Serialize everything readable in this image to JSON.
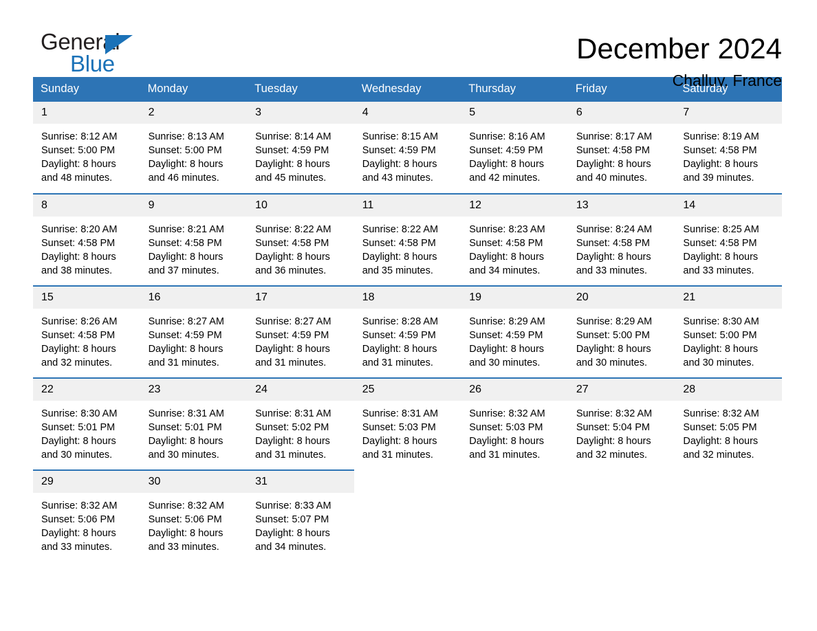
{
  "brand": {
    "name_top": "General",
    "name_bottom": "Blue",
    "triangle_color": "#1b72b8",
    "top_color": "#231f20"
  },
  "header": {
    "title": "December 2024",
    "subtitle": "Challuy, France"
  },
  "theme": {
    "header_blue": "#2d74b5",
    "row_separator": "#2d74b5",
    "daynum_band": "#f0f0f0",
    "page_background": "#ffffff",
    "text": "#000000"
  },
  "calendar": {
    "weekday_headers": [
      "Sunday",
      "Monday",
      "Tuesday",
      "Wednesday",
      "Thursday",
      "Friday",
      "Saturday"
    ],
    "labels": {
      "sunrise": "Sunrise:",
      "sunset": "Sunset:",
      "daylight": "Daylight:"
    },
    "weeks": [
      [
        {
          "day": "1",
          "sunrise": "Sunrise: 8:12 AM",
          "sunset": "Sunset: 5:00 PM",
          "daylight_1": "Daylight: 8 hours",
          "daylight_2": "and 48 minutes."
        },
        {
          "day": "2",
          "sunrise": "Sunrise: 8:13 AM",
          "sunset": "Sunset: 5:00 PM",
          "daylight_1": "Daylight: 8 hours",
          "daylight_2": "and 46 minutes."
        },
        {
          "day": "3",
          "sunrise": "Sunrise: 8:14 AM",
          "sunset": "Sunset: 4:59 PM",
          "daylight_1": "Daylight: 8 hours",
          "daylight_2": "and 45 minutes."
        },
        {
          "day": "4",
          "sunrise": "Sunrise: 8:15 AM",
          "sunset": "Sunset: 4:59 PM",
          "daylight_1": "Daylight: 8 hours",
          "daylight_2": "and 43 minutes."
        },
        {
          "day": "5",
          "sunrise": "Sunrise: 8:16 AM",
          "sunset": "Sunset: 4:59 PM",
          "daylight_1": "Daylight: 8 hours",
          "daylight_2": "and 42 minutes."
        },
        {
          "day": "6",
          "sunrise": "Sunrise: 8:17 AM",
          "sunset": "Sunset: 4:58 PM",
          "daylight_1": "Daylight: 8 hours",
          "daylight_2": "and 40 minutes."
        },
        {
          "day": "7",
          "sunrise": "Sunrise: 8:19 AM",
          "sunset": "Sunset: 4:58 PM",
          "daylight_1": "Daylight: 8 hours",
          "daylight_2": "and 39 minutes."
        }
      ],
      [
        {
          "day": "8",
          "sunrise": "Sunrise: 8:20 AM",
          "sunset": "Sunset: 4:58 PM",
          "daylight_1": "Daylight: 8 hours",
          "daylight_2": "and 38 minutes."
        },
        {
          "day": "9",
          "sunrise": "Sunrise: 8:21 AM",
          "sunset": "Sunset: 4:58 PM",
          "daylight_1": "Daylight: 8 hours",
          "daylight_2": "and 37 minutes."
        },
        {
          "day": "10",
          "sunrise": "Sunrise: 8:22 AM",
          "sunset": "Sunset: 4:58 PM",
          "daylight_1": "Daylight: 8 hours",
          "daylight_2": "and 36 minutes."
        },
        {
          "day": "11",
          "sunrise": "Sunrise: 8:22 AM",
          "sunset": "Sunset: 4:58 PM",
          "daylight_1": "Daylight: 8 hours",
          "daylight_2": "and 35 minutes."
        },
        {
          "day": "12",
          "sunrise": "Sunrise: 8:23 AM",
          "sunset": "Sunset: 4:58 PM",
          "daylight_1": "Daylight: 8 hours",
          "daylight_2": "and 34 minutes."
        },
        {
          "day": "13",
          "sunrise": "Sunrise: 8:24 AM",
          "sunset": "Sunset: 4:58 PM",
          "daylight_1": "Daylight: 8 hours",
          "daylight_2": "and 33 minutes."
        },
        {
          "day": "14",
          "sunrise": "Sunrise: 8:25 AM",
          "sunset": "Sunset: 4:58 PM",
          "daylight_1": "Daylight: 8 hours",
          "daylight_2": "and 33 minutes."
        }
      ],
      [
        {
          "day": "15",
          "sunrise": "Sunrise: 8:26 AM",
          "sunset": "Sunset: 4:58 PM",
          "daylight_1": "Daylight: 8 hours",
          "daylight_2": "and 32 minutes."
        },
        {
          "day": "16",
          "sunrise": "Sunrise: 8:27 AM",
          "sunset": "Sunset: 4:59 PM",
          "daylight_1": "Daylight: 8 hours",
          "daylight_2": "and 31 minutes."
        },
        {
          "day": "17",
          "sunrise": "Sunrise: 8:27 AM",
          "sunset": "Sunset: 4:59 PM",
          "daylight_1": "Daylight: 8 hours",
          "daylight_2": "and 31 minutes."
        },
        {
          "day": "18",
          "sunrise": "Sunrise: 8:28 AM",
          "sunset": "Sunset: 4:59 PM",
          "daylight_1": "Daylight: 8 hours",
          "daylight_2": "and 31 minutes."
        },
        {
          "day": "19",
          "sunrise": "Sunrise: 8:29 AM",
          "sunset": "Sunset: 4:59 PM",
          "daylight_1": "Daylight: 8 hours",
          "daylight_2": "and 30 minutes."
        },
        {
          "day": "20",
          "sunrise": "Sunrise: 8:29 AM",
          "sunset": "Sunset: 5:00 PM",
          "daylight_1": "Daylight: 8 hours",
          "daylight_2": "and 30 minutes."
        },
        {
          "day": "21",
          "sunrise": "Sunrise: 8:30 AM",
          "sunset": "Sunset: 5:00 PM",
          "daylight_1": "Daylight: 8 hours",
          "daylight_2": "and 30 minutes."
        }
      ],
      [
        {
          "day": "22",
          "sunrise": "Sunrise: 8:30 AM",
          "sunset": "Sunset: 5:01 PM",
          "daylight_1": "Daylight: 8 hours",
          "daylight_2": "and 30 minutes."
        },
        {
          "day": "23",
          "sunrise": "Sunrise: 8:31 AM",
          "sunset": "Sunset: 5:01 PM",
          "daylight_1": "Daylight: 8 hours",
          "daylight_2": "and 30 minutes."
        },
        {
          "day": "24",
          "sunrise": "Sunrise: 8:31 AM",
          "sunset": "Sunset: 5:02 PM",
          "daylight_1": "Daylight: 8 hours",
          "daylight_2": "and 31 minutes."
        },
        {
          "day": "25",
          "sunrise": "Sunrise: 8:31 AM",
          "sunset": "Sunset: 5:03 PM",
          "daylight_1": "Daylight: 8 hours",
          "daylight_2": "and 31 minutes."
        },
        {
          "day": "26",
          "sunrise": "Sunrise: 8:32 AM",
          "sunset": "Sunset: 5:03 PM",
          "daylight_1": "Daylight: 8 hours",
          "daylight_2": "and 31 minutes."
        },
        {
          "day": "27",
          "sunrise": "Sunrise: 8:32 AM",
          "sunset": "Sunset: 5:04 PM",
          "daylight_1": "Daylight: 8 hours",
          "daylight_2": "and 32 minutes."
        },
        {
          "day": "28",
          "sunrise": "Sunrise: 8:32 AM",
          "sunset": "Sunset: 5:05 PM",
          "daylight_1": "Daylight: 8 hours",
          "daylight_2": "and 32 minutes."
        }
      ],
      [
        {
          "day": "29",
          "sunrise": "Sunrise: 8:32 AM",
          "sunset": "Sunset: 5:06 PM",
          "daylight_1": "Daylight: 8 hours",
          "daylight_2": "and 33 minutes."
        },
        {
          "day": "30",
          "sunrise": "Sunrise: 8:32 AM",
          "sunset": "Sunset: 5:06 PM",
          "daylight_1": "Daylight: 8 hours",
          "daylight_2": "and 33 minutes."
        },
        {
          "day": "31",
          "sunrise": "Sunrise: 8:33 AM",
          "sunset": "Sunset: 5:07 PM",
          "daylight_1": "Daylight: 8 hours",
          "daylight_2": "and 34 minutes."
        },
        {
          "day": "",
          "sunrise": "",
          "sunset": "",
          "daylight_1": "",
          "daylight_2": "",
          "empty": true
        },
        {
          "day": "",
          "sunrise": "",
          "sunset": "",
          "daylight_1": "",
          "daylight_2": "",
          "empty": true
        },
        {
          "day": "",
          "sunrise": "",
          "sunset": "",
          "daylight_1": "",
          "daylight_2": "",
          "empty": true
        },
        {
          "day": "",
          "sunrise": "",
          "sunset": "",
          "daylight_1": "",
          "daylight_2": "",
          "empty": true
        }
      ]
    ]
  }
}
